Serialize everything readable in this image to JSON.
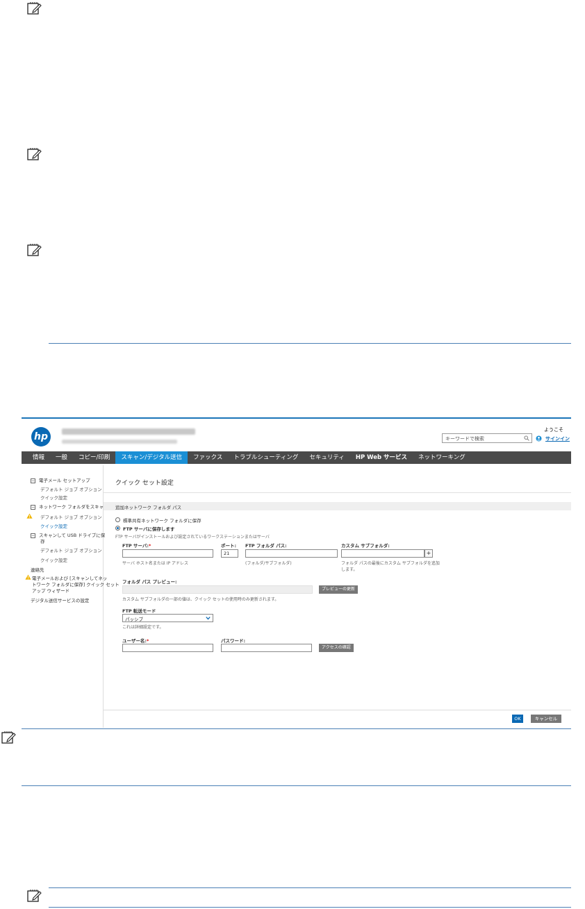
{
  "header": {
    "welcome": "ようこそ",
    "sign_in": "サインイン",
    "search_placeholder": "キーワードで検索"
  },
  "nav": [
    "情報",
    "一般",
    "コピー/印刷",
    "スキャン/デジタル送信",
    "ファックス",
    "トラブルシューティング",
    "セキュリティ",
    "HP Web サービス",
    "ネットワーキング"
  ],
  "sidebar": {
    "email_setup": "電子メール セットアップ",
    "default_job_options_1": "デフォルト ジョブ オプション",
    "quick_sets_1": "クイック設定",
    "scan_to_network_folder": "ネットワーク フォルダをスキャン",
    "default_job_options_2": "デフォルト ジョブ オプション",
    "quick_sets_2": "クイック設定",
    "scan_to_usb_line1": "スキャンして USB ドライブに保",
    "scan_to_usb_line2": "存",
    "default_job_options_3": "デフォルト ジョブ オプション",
    "quick_sets_3": "クイック設定",
    "contacts": "連絡先",
    "wizard_line1": "電子メールおよび [スキャンしてネッ",
    "wizard_line2": "トワーク フォルダに保存] クイック セット",
    "wizard_line3": "アップ ウィザード",
    "digital_sending": "デジタル送信サービスの設定"
  },
  "main": {
    "title": "クイック セット設定",
    "section": "追加ネットワーク フォルダ パス",
    "radio_standard": "標準共有ネットワーク フォルダに保存",
    "radio_ftp": "FTP サーバに保存します",
    "ftp_desc": "FTP サーバがインストールおよび設定されているワークステーションまたはサーバ",
    "ftp_server_label": "FTP サーバ:",
    "ftp_server_hint": "サーバ ホスト名または IP アドレス",
    "port_label": "ポート:",
    "port_value": "21",
    "ftp_folder_label": "FTP フォルダ パス:",
    "ftp_folder_hint": "(フォルダ/サブフォルダ)",
    "custom_subfolder_label": "カスタム サブフォルダ:",
    "custom_subfolder_hint_1": "フォルダ パスの最後にカスタム サブフォルダを追加",
    "custom_subfolder_hint_2": "します。",
    "preview_label": "フォルダ パス プレビュー:",
    "preview_button": "プレビューの更新",
    "preview_note": "カスタム サブフォルダの一部の値は、クイック セットの使用時のみ更新されます。",
    "transfer_mode_label": "FTP 転送モード",
    "transfer_mode_value": "パッシブ",
    "transfer_mode_note": "これは詳細設定です。",
    "username_label": "ユーザー名:",
    "password_label": "パスワード:",
    "verify_button": "アクセスの確認",
    "required_mark": "*"
  },
  "footer": {
    "ok": "OK",
    "cancel": "キャンセル"
  },
  "colors": {
    "accent": "#1a8fd5",
    "navbar": "#4a4a4a",
    "hp_blue": "#0a69b4",
    "rule_blue": "#4a7fb5"
  }
}
